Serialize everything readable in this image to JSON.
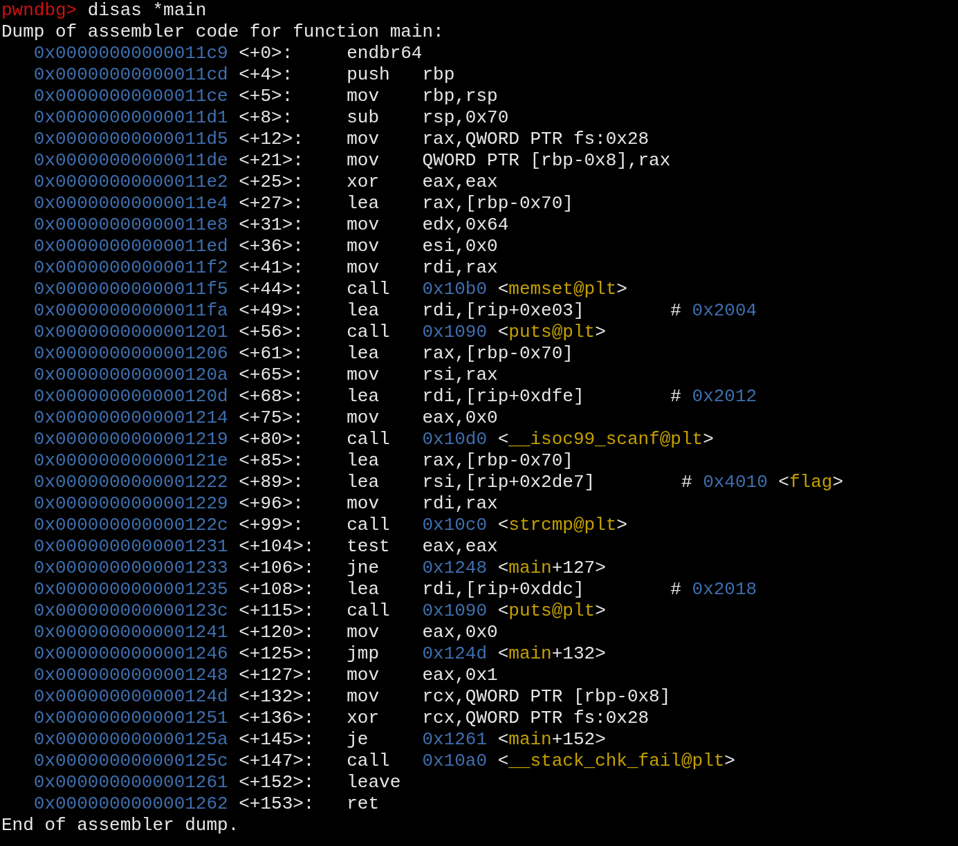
{
  "prompt": {
    "label": "pwndbg>",
    "command": "disas *main"
  },
  "header": "Dump of assembler code for function main:",
  "rows": [
    {
      "address": "0x00000000000011c9",
      "offset": "<+0>:",
      "mnemonic": "endbr64"
    },
    {
      "address": "0x00000000000011cd",
      "offset": "<+4>:",
      "mnemonic": "push",
      "operands": "rbp"
    },
    {
      "address": "0x00000000000011ce",
      "offset": "<+5>:",
      "mnemonic": "mov",
      "operands": "rbp,rsp"
    },
    {
      "address": "0x00000000000011d1",
      "offset": "<+8>:",
      "mnemonic": "sub",
      "operands": "rsp,0x70"
    },
    {
      "address": "0x00000000000011d5",
      "offset": "<+12>:",
      "mnemonic": "mov",
      "operands": "rax,QWORD PTR fs:0x28"
    },
    {
      "address": "0x00000000000011de",
      "offset": "<+21>:",
      "mnemonic": "mov",
      "operands": "QWORD PTR [rbp-0x8],rax"
    },
    {
      "address": "0x00000000000011e2",
      "offset": "<+25>:",
      "mnemonic": "xor",
      "operands": "eax,eax"
    },
    {
      "address": "0x00000000000011e4",
      "offset": "<+27>:",
      "mnemonic": "lea",
      "operands": "rax,[rbp-0x70]"
    },
    {
      "address": "0x00000000000011e8",
      "offset": "<+31>:",
      "mnemonic": "mov",
      "operands": "edx,0x64"
    },
    {
      "address": "0x00000000000011ed",
      "offset": "<+36>:",
      "mnemonic": "mov",
      "operands": "esi,0x0"
    },
    {
      "address": "0x00000000000011f2",
      "offset": "<+41>:",
      "mnemonic": "mov",
      "operands": "rdi,rax"
    },
    {
      "address": "0x00000000000011f5",
      "offset": "<+44>:",
      "mnemonic": "call",
      "target": "0x10b0",
      "symbol": {
        "open": "<",
        "name": "memset@plt",
        "close": ">"
      }
    },
    {
      "address": "0x00000000000011fa",
      "offset": "<+49>:",
      "mnemonic": "lea",
      "operands": "rdi,[rip+0xe03]",
      "comment": {
        "hash": "#",
        "address": "0x2004"
      }
    },
    {
      "address": "0x0000000000001201",
      "offset": "<+56>:",
      "mnemonic": "call",
      "target": "0x1090",
      "symbol": {
        "open": "<",
        "name": "puts@plt",
        "close": ">"
      }
    },
    {
      "address": "0x0000000000001206",
      "offset": "<+61>:",
      "mnemonic": "lea",
      "operands": "rax,[rbp-0x70]"
    },
    {
      "address": "0x000000000000120a",
      "offset": "<+65>:",
      "mnemonic": "mov",
      "operands": "rsi,rax"
    },
    {
      "address": "0x000000000000120d",
      "offset": "<+68>:",
      "mnemonic": "lea",
      "operands": "rdi,[rip+0xdfe]",
      "comment": {
        "hash": "#",
        "address": "0x2012"
      }
    },
    {
      "address": "0x0000000000001214",
      "offset": "<+75>:",
      "mnemonic": "mov",
      "operands": "eax,0x0"
    },
    {
      "address": "0x0000000000001219",
      "offset": "<+80>:",
      "mnemonic": "call",
      "target": "0x10d0",
      "symbol": {
        "open": "<",
        "name": "__isoc99_scanf@plt",
        "close": ">"
      }
    },
    {
      "address": "0x000000000000121e",
      "offset": "<+85>:",
      "mnemonic": "lea",
      "operands": "rax,[rbp-0x70]"
    },
    {
      "address": "0x0000000000001222",
      "offset": "<+89>:",
      "mnemonic": "lea",
      "operands": "rsi,[rip+0x2de7]",
      "comment": {
        "hash": "#",
        "address": "0x4010",
        "symbol": {
          "open": "<",
          "name": "flag",
          "close": ">"
        }
      }
    },
    {
      "address": "0x0000000000001229",
      "offset": "<+96>:",
      "mnemonic": "mov",
      "operands": "rdi,rax"
    },
    {
      "address": "0x000000000000122c",
      "offset": "<+99>:",
      "mnemonic": "call",
      "target": "0x10c0",
      "symbol": {
        "open": "<",
        "name": "strcmp@plt",
        "close": ">"
      }
    },
    {
      "address": "0x0000000000001231",
      "offset": "<+104>:",
      "mnemonic": "test",
      "operands": "eax,eax"
    },
    {
      "address": "0x0000000000001233",
      "offset": "<+106>:",
      "mnemonic": "jne",
      "target": "0x1248",
      "symbol": {
        "open": "<",
        "name": "main",
        "close": "+127>"
      }
    },
    {
      "address": "0x0000000000001235",
      "offset": "<+108>:",
      "mnemonic": "lea",
      "operands": "rdi,[rip+0xddc]",
      "comment": {
        "hash": "#",
        "address": "0x2018"
      }
    },
    {
      "address": "0x000000000000123c",
      "offset": "<+115>:",
      "mnemonic": "call",
      "target": "0x1090",
      "symbol": {
        "open": "<",
        "name": "puts@plt",
        "close": ">"
      }
    },
    {
      "address": "0x0000000000001241",
      "offset": "<+120>:",
      "mnemonic": "mov",
      "operands": "eax,0x0"
    },
    {
      "address": "0x0000000000001246",
      "offset": "<+125>:",
      "mnemonic": "jmp",
      "target": "0x124d",
      "symbol": {
        "open": "<",
        "name": "main",
        "close": "+132>"
      }
    },
    {
      "address": "0x0000000000001248",
      "offset": "<+127>:",
      "mnemonic": "mov",
      "operands": "eax,0x1"
    },
    {
      "address": "0x000000000000124d",
      "offset": "<+132>:",
      "mnemonic": "mov",
      "operands": "rcx,QWORD PTR [rbp-0x8]"
    },
    {
      "address": "0x0000000000001251",
      "offset": "<+136>:",
      "mnemonic": "xor",
      "operands": "rcx,QWORD PTR fs:0x28"
    },
    {
      "address": "0x000000000000125a",
      "offset": "<+145>:",
      "mnemonic": "je",
      "target": "0x1261",
      "symbol": {
        "open": "<",
        "name": "main",
        "close": "+152>"
      }
    },
    {
      "address": "0x000000000000125c",
      "offset": "<+147>:",
      "mnemonic": "call",
      "target": "0x10a0",
      "symbol": {
        "open": "<",
        "name": "__stack_chk_fail@plt",
        "close": ">"
      }
    },
    {
      "address": "0x0000000000001261",
      "offset": "<+152>:",
      "mnemonic": "leave"
    },
    {
      "address": "0x0000000000001262",
      "offset": "<+153>:",
      "mnemonic": "ret"
    }
  ],
  "footer": "End of assembler dump."
}
